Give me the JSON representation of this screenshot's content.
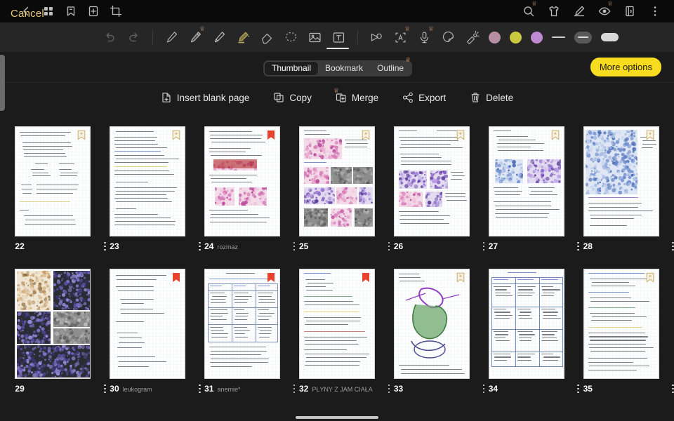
{
  "topbar": {
    "left_icons": [
      {
        "name": "back-chevron-icon",
        "glyph": "chevron-left"
      },
      {
        "name": "grid-view-icon",
        "glyph": "grid"
      },
      {
        "name": "bookmark-icon",
        "glyph": "bookmark"
      },
      {
        "name": "add-page-icon",
        "glyph": "plus-box"
      },
      {
        "name": "crop-icon",
        "glyph": "crop"
      }
    ],
    "right_icons": [
      {
        "name": "search-icon",
        "glyph": "search",
        "premium": true
      },
      {
        "name": "shirt-icon",
        "glyph": "shirt",
        "premium": false
      },
      {
        "name": "annotate-icon",
        "glyph": "pen-ruler",
        "premium": false
      },
      {
        "name": "read-aloud-icon",
        "glyph": "eye",
        "premium": true
      },
      {
        "name": "page-layout-icon",
        "glyph": "page",
        "premium": false
      },
      {
        "name": "overflow-menu-icon",
        "glyph": "kebab",
        "premium": false
      }
    ]
  },
  "toolbar": {
    "items": [
      {
        "name": "undo-button",
        "glyph": "undo",
        "disabled": true
      },
      {
        "name": "redo-button",
        "glyph": "redo",
        "disabled": true
      },
      {
        "name": "separator",
        "glyph": "sep",
        "disabled": false
      },
      {
        "name": "thin-pen-tool",
        "glyph": "pen-thin",
        "disabled": false
      },
      {
        "name": "pencil-tool",
        "glyph": "pencil",
        "disabled": false,
        "premium": true
      },
      {
        "name": "fountain-pen-tool",
        "glyph": "pen",
        "disabled": false,
        "selected": true
      },
      {
        "name": "highlighter-tool",
        "glyph": "highlighter",
        "disabled": false,
        "has_chevron": true
      },
      {
        "name": "eraser-tool",
        "glyph": "eraser",
        "disabled": false
      },
      {
        "name": "lasso-select-tool",
        "glyph": "lasso",
        "disabled": false
      },
      {
        "name": "insert-image-tool",
        "glyph": "image",
        "disabled": false
      },
      {
        "name": "text-box-tool",
        "glyph": "text-box",
        "disabled": false
      },
      {
        "name": "separator2",
        "glyph": "sep",
        "disabled": false
      },
      {
        "name": "shape-tool",
        "glyph": "shape",
        "disabled": false
      },
      {
        "name": "ocr-text-tool",
        "glyph": "ocr-a",
        "disabled": false,
        "premium": true
      },
      {
        "name": "voice-record-tool",
        "glyph": "mic",
        "disabled": false,
        "premium": true
      },
      {
        "name": "sticker-tool",
        "glyph": "sticker",
        "disabled": false
      },
      {
        "name": "laser-pointer-tool",
        "glyph": "laser",
        "disabled": false
      }
    ],
    "colors": [
      {
        "name": "color-swatch-mauve",
        "hex": "#b68ea4"
      },
      {
        "name": "color-swatch-olive",
        "hex": "#c9c83f"
      },
      {
        "name": "color-swatch-orchid",
        "hex": "#c08ad2"
      }
    ],
    "stroke_controls": [
      {
        "name": "stroke-thin-preview",
        "glyph": "thin-line"
      },
      {
        "name": "stroke-medium-button",
        "glyph": "pill-dark"
      },
      {
        "name": "stroke-thick-button",
        "glyph": "pill-light"
      }
    ]
  },
  "panel": {
    "cancel_label": "Cancel",
    "more_options_label": "More options",
    "tabs": [
      {
        "label": "Thumbnail",
        "active": true,
        "premium": false
      },
      {
        "label": "Bookmark",
        "active": false,
        "premium": false
      },
      {
        "label": "Outline",
        "active": false,
        "premium": true
      }
    ]
  },
  "actions": [
    {
      "label": "Insert blank page",
      "icon": "insert-blank-page-icon",
      "premium": false
    },
    {
      "label": "Copy",
      "icon": "copy-icon",
      "premium": false
    },
    {
      "label": "Merge",
      "icon": "merge-icon",
      "premium": true
    },
    {
      "label": "Export",
      "icon": "export-icon",
      "premium": false
    },
    {
      "label": "Delete",
      "icon": "delete-icon",
      "premium": false
    }
  ],
  "pages": [
    {
      "number": "22",
      "title": "",
      "bookmark": "outline",
      "style": "notes-mixed"
    },
    {
      "number": "23",
      "title": "",
      "bookmark": "outline",
      "style": "notes-dense"
    },
    {
      "number": "24",
      "title": "rozmaz",
      "bookmark": "red",
      "style": "notes-red-image"
    },
    {
      "number": "25",
      "title": "",
      "bookmark": "outline",
      "style": "micro-photos"
    },
    {
      "number": "26",
      "title": "",
      "bookmark": "outline",
      "style": "micro-grid"
    },
    {
      "number": "27",
      "title": "",
      "bookmark": "outline",
      "style": "tubes-photo"
    },
    {
      "number": "28",
      "title": "",
      "bookmark": "outline",
      "style": "blood-smear"
    },
    {
      "number": "29",
      "title": "",
      "bookmark": "none",
      "style": "photo-collage"
    },
    {
      "number": "30",
      "title": "leukogram",
      "bookmark": "red",
      "style": "notes-plain"
    },
    {
      "number": "31",
      "title": "anemie*",
      "bookmark": "red",
      "style": "table-notes"
    },
    {
      "number": "32",
      "title": "PŁYNY Z JAM CIAŁA",
      "bookmark": "red",
      "style": "notes-color"
    },
    {
      "number": "33",
      "title": "",
      "bookmark": "outline",
      "style": "diagram-heart"
    },
    {
      "number": "34",
      "title": "",
      "bookmark": "none",
      "style": "table-blue"
    },
    {
      "number": "35",
      "title": "",
      "bookmark": "outline",
      "style": "notes-blue"
    }
  ]
}
